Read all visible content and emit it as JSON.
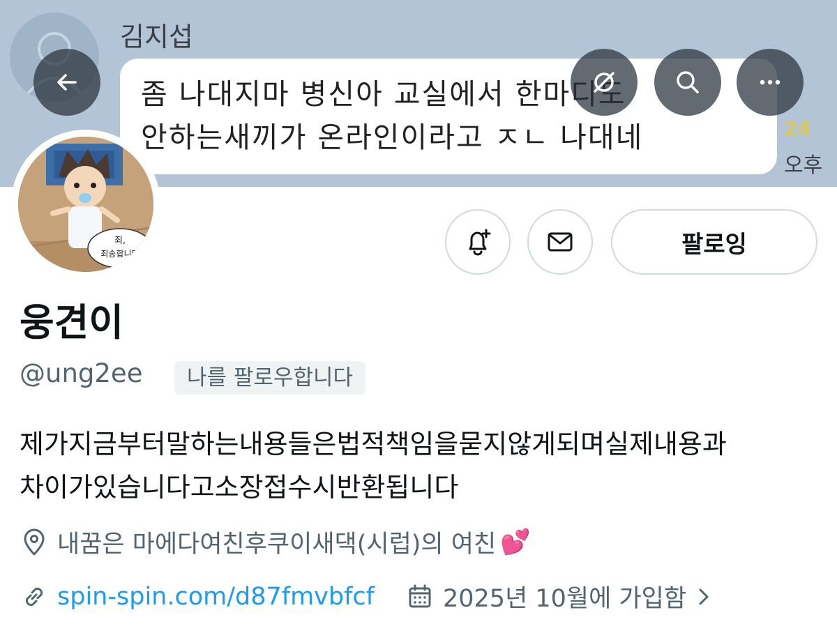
{
  "banner": {
    "chat_sender": "김지섭",
    "chat_message_lines": [
      "좀 나대지마 병신아 교실에서 한마디도",
      "안하는새끼가 온라인이라고 ㅈㄴ 나대네"
    ],
    "chat_count": "24",
    "chat_time": "오후"
  },
  "header_buttons": {
    "back_icon": "arrow-left-icon",
    "grok_icon": "grok-icon",
    "search_icon": "search-icon",
    "more_icon": "more-icon"
  },
  "avatar": {
    "speech_text_line1": "죄,",
    "speech_text_line2": "죄송합니다"
  },
  "actions": {
    "notify_icon": "bell-plus-icon",
    "message_icon": "envelope-icon",
    "follow_label": "팔로잉"
  },
  "profile": {
    "display_name": "웅견이",
    "handle": "@ung2ee",
    "follows_you": "나를 팔로우합니다",
    "bio_lines": [
      "제가지금부터말하는내용들은법적책임을묻지않게되며실제내용과",
      "차이가있습니다고소장접수시반환됩니다"
    ],
    "location": "내꿈은 마에다여친후쿠이새댁(시럽)의 여친",
    "location_emoji": "💕",
    "website": "spin-spin.com/d87fmvbfcf",
    "joined": "2025년 10월에 가입함"
  },
  "colors": {
    "link": "#1d9bf0",
    "secondary_text": "#536471",
    "border": "#cfd9de",
    "banner_bg": "#b3c4d6"
  }
}
